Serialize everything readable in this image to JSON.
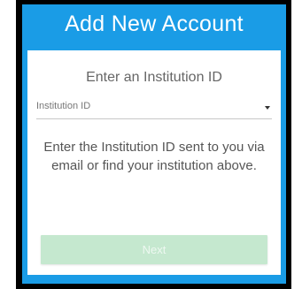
{
  "dialog": {
    "title": "Add New Account",
    "heading": "Enter an Institution ID",
    "institution_select": {
      "selected": "Institution ID"
    },
    "help_text": "Enter the Institution ID sent to you via email or find your institution above.",
    "next_label": "Next",
    "next_state": "disabled"
  },
  "colors": {
    "header_bg": "#1a9ce6",
    "button_disabled_bg": "#c5e8cf"
  },
  "icons": {
    "dropdown": "caret-down-icon"
  }
}
